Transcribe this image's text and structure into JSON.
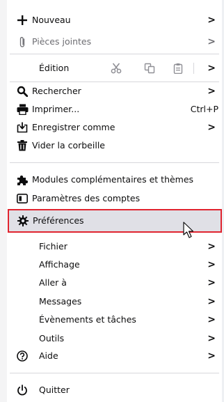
{
  "menu": {
    "nouveau": "Nouveau",
    "pieces_jointes": "Pièces jointes",
    "edition": "Édition",
    "rechercher": "Rechercher",
    "imprimer": "Imprimer...",
    "imprimer_shortcut": "Ctrl+P",
    "enregistrer": "Enregistrer comme",
    "vider": "Vider la corbeille",
    "modules": "Modules complémentaires et thèmes",
    "parametres_comptes": "Paramètres des comptes",
    "preferences": "Préférences",
    "fichier": "Fichier",
    "affichage": "Affichage",
    "aller": "Aller à",
    "messages": "Messages",
    "evenements": "Évènements et tâches",
    "outils": "Outils",
    "aide": "Aide",
    "quitter": "Quitter"
  },
  "chevron": ">",
  "colors": {
    "highlight_border": "#e0242f",
    "hover_bg": "#e0e0e6",
    "separator": "#d7d7db"
  }
}
